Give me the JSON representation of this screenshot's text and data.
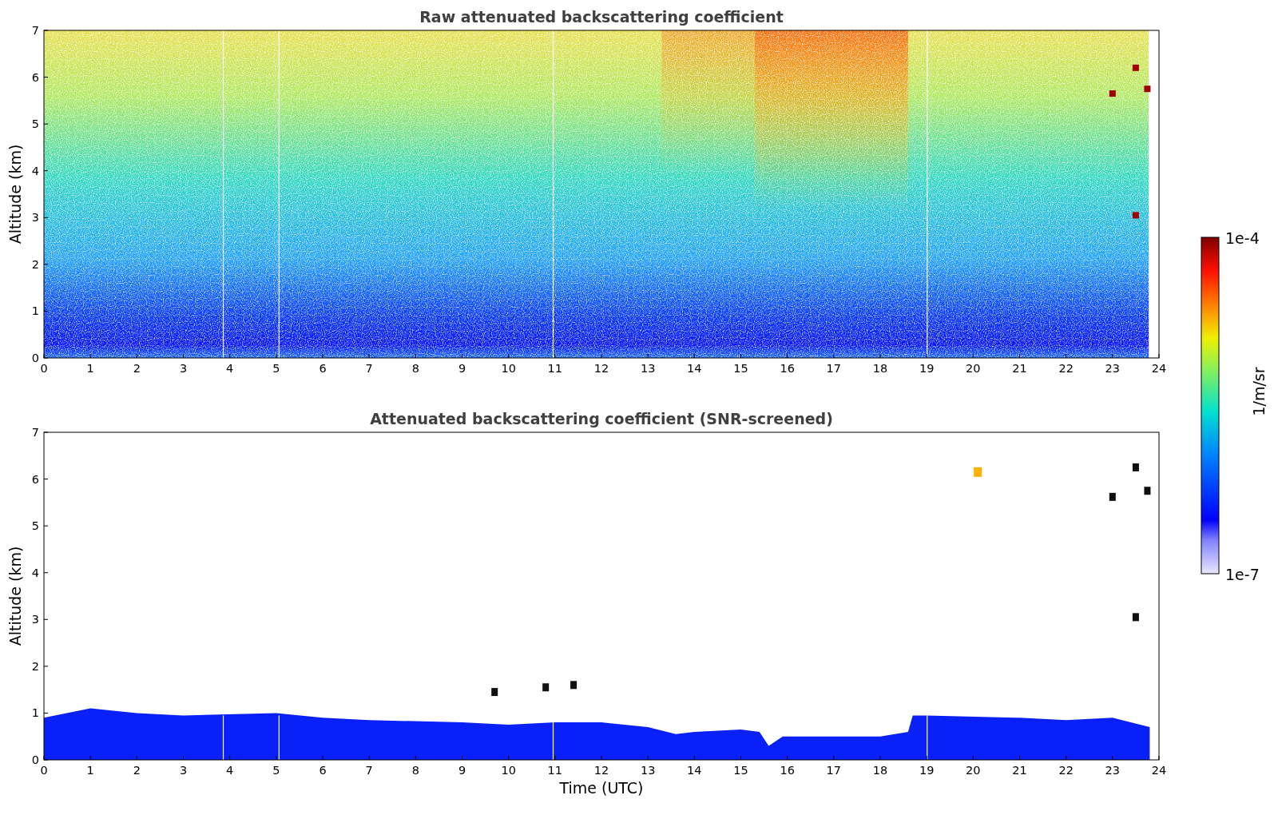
{
  "panels": [
    {
      "title": "Raw attenuated backscattering coefficient",
      "ylabel": "Altitude (km)",
      "kind": "raw",
      "yticks": [
        "7",
        "6",
        "5",
        "4",
        "3",
        "2",
        "1",
        "0"
      ],
      "xticks": [
        "0",
        "1",
        "2",
        "3",
        "4",
        "5",
        "6",
        "7",
        "8",
        "9",
        "10",
        "11",
        "12",
        "13",
        "14",
        "15",
        "16",
        "17",
        "18",
        "19",
        "20",
        "21",
        "22",
        "23",
        "24"
      ]
    },
    {
      "title": "Attenuated backscattering coefficient (SNR-screened)",
      "ylabel": "Altitude (km)",
      "kind": "screened",
      "xlabel": "Time (UTC)",
      "yticks": [
        "7",
        "6",
        "5",
        "4",
        "3",
        "2",
        "1",
        "0"
      ],
      "xticks": [
        "0",
        "1",
        "2",
        "3",
        "4",
        "5",
        "6",
        "7",
        "8",
        "9",
        "10",
        "11",
        "12",
        "13",
        "14",
        "15",
        "16",
        "17",
        "18",
        "19",
        "20",
        "21",
        "22",
        "23",
        "24"
      ]
    }
  ],
  "colorbar": {
    "max_label": "1e-4",
    "min_label": "1e-7",
    "label": "1/m/sr"
  }
}
